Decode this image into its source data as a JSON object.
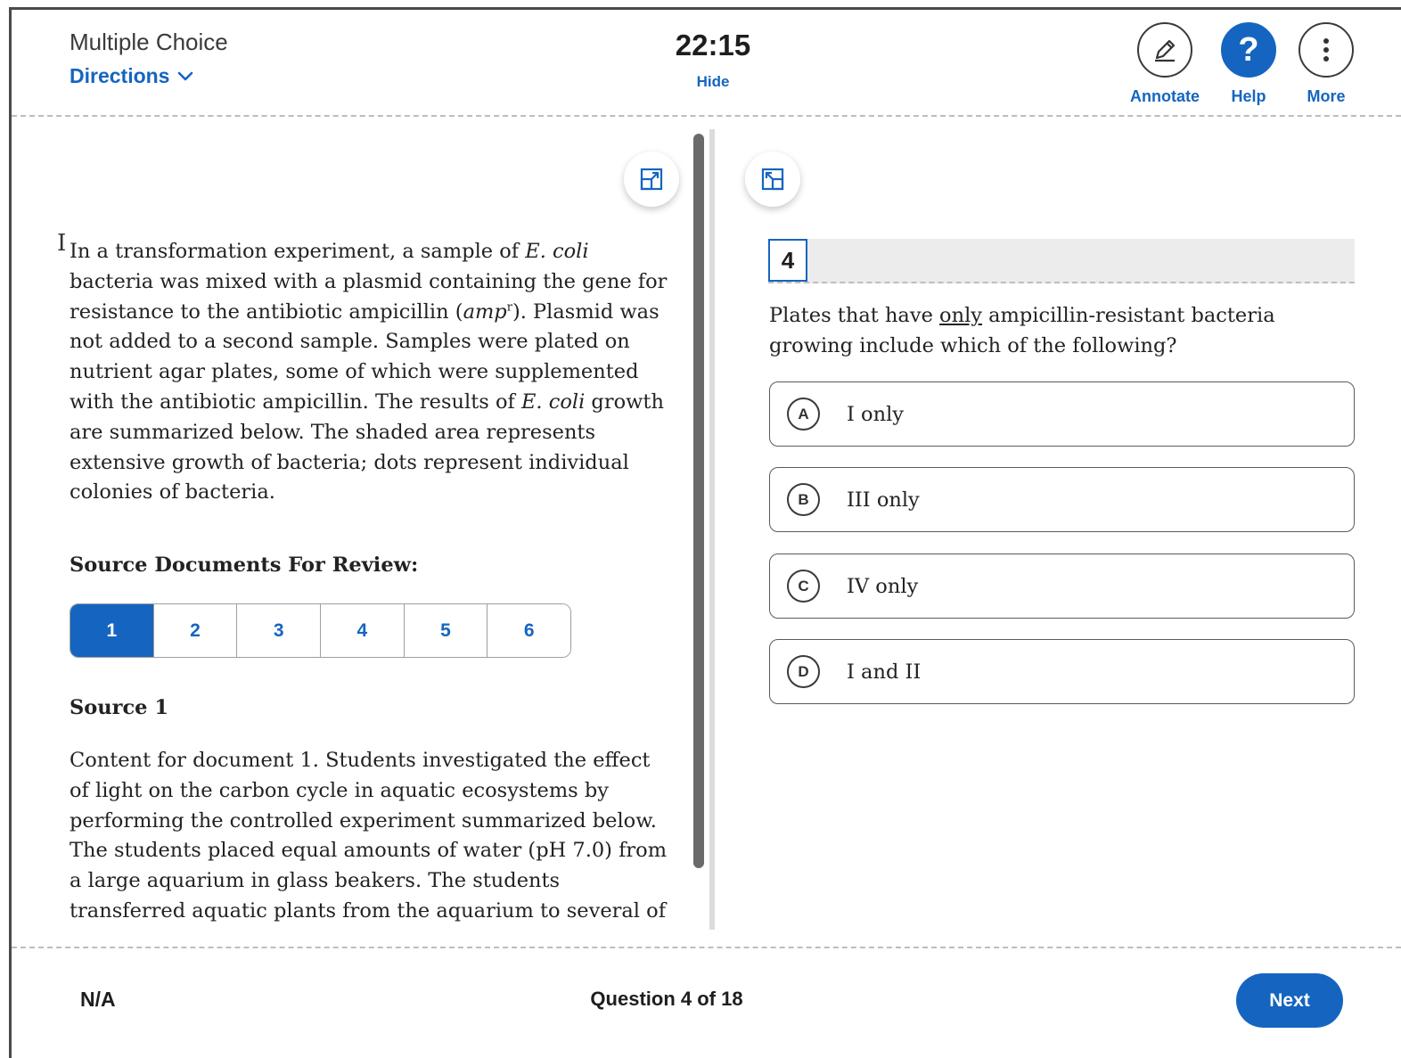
{
  "header": {
    "section_title": "Multiple Choice",
    "directions_label": "Directions",
    "timer": "22:15",
    "hide_label": "Hide",
    "tools": {
      "annotate_label": "Annotate",
      "help_label": "Help",
      "help_glyph": "?",
      "more_label": "More"
    }
  },
  "passage": {
    "p1": "In a transformation experiment, a sample of ",
    "p1_ital": "E. coli",
    "p2": " bacteria was mixed with a plasmid containing the gene for resistance to the antibiotic ampicillin (",
    "p2_ital": "amp",
    "p2_sup": "r",
    "p3": "). Plasmid was not added to a second sample. Samples were plated on nutrient agar plates, some of which were supplemented with the antibiotic ampicillin. The results of ",
    "p3_ital": "E. coli",
    "p4": " growth are summarized below. The shaded area represents extensive growth of bacteria; dots represent individual colonies of bacteria."
  },
  "sources": {
    "heading": "Source Documents For Review:",
    "tabs": [
      "1",
      "2",
      "3",
      "4",
      "5",
      "6"
    ],
    "active_index": 0,
    "current_name": "Source 1",
    "content": "Content for document 1. Students investigated the effect of light on the carbon cycle in aquatic ecosystems by performing the controlled experiment summarized below. The students placed equal amounts of water (pH 7.0) from a large aquarium in glass beakers. The students transferred aquatic plants from the aquarium to several of the beakers,"
  },
  "question": {
    "number": "4",
    "stem_pre": "Plates that have ",
    "stem_underlined": "only",
    "stem_post": " ampicillin-resistant bacteria growing include which of the following?",
    "choices": [
      {
        "letter": "A",
        "text": "I only"
      },
      {
        "letter": "B",
        "text": "III only"
      },
      {
        "letter": "C",
        "text": "IV only"
      },
      {
        "letter": "D",
        "text": "I and II"
      }
    ]
  },
  "footer": {
    "status": "N/A",
    "progress": "Question 4 of 18",
    "next_label": "Next"
  },
  "colors": {
    "accent": "#1565c0",
    "text": "#1e1e1e",
    "divider": "#bdbdbd"
  },
  "icons": [
    "chevron-down-icon",
    "pencil-icon",
    "help-icon",
    "more-vertical-icon",
    "expand-pane-icon",
    "collapse-pane-icon",
    "text-cursor-icon"
  ]
}
